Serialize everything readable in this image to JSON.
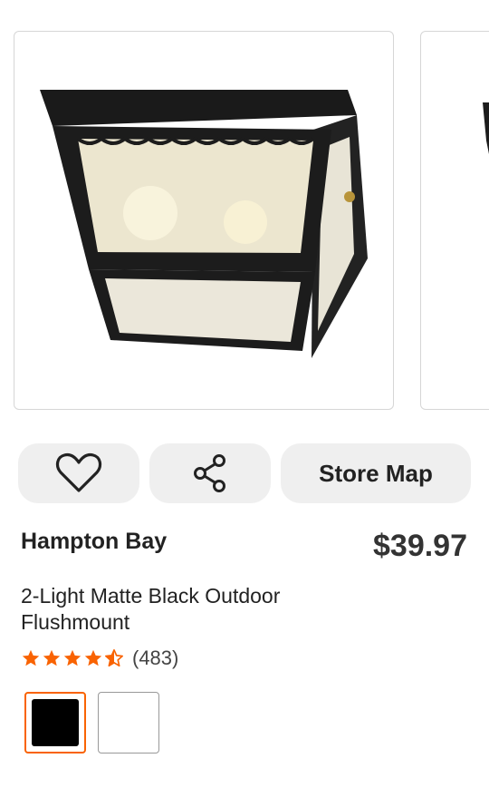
{
  "gallery": {
    "image_alt": "2-Light Matte Black Outdoor Flushmount"
  },
  "actions": {
    "favorite_icon": "heart-icon",
    "share_icon": "share-icon",
    "store_map_label": "Store Map"
  },
  "product": {
    "brand": "Hampton Bay",
    "price": "$39.97",
    "title": "2-Light Matte Black Outdoor Flushmount",
    "rating": {
      "stars": 4.5,
      "count_label": "(483)"
    },
    "swatches": [
      {
        "color": "#000000",
        "selected": true
      },
      {
        "color": "#ffffff",
        "selected": false
      }
    ]
  },
  "colors": {
    "accent": "#f96302",
    "button_bg": "#efefef"
  }
}
